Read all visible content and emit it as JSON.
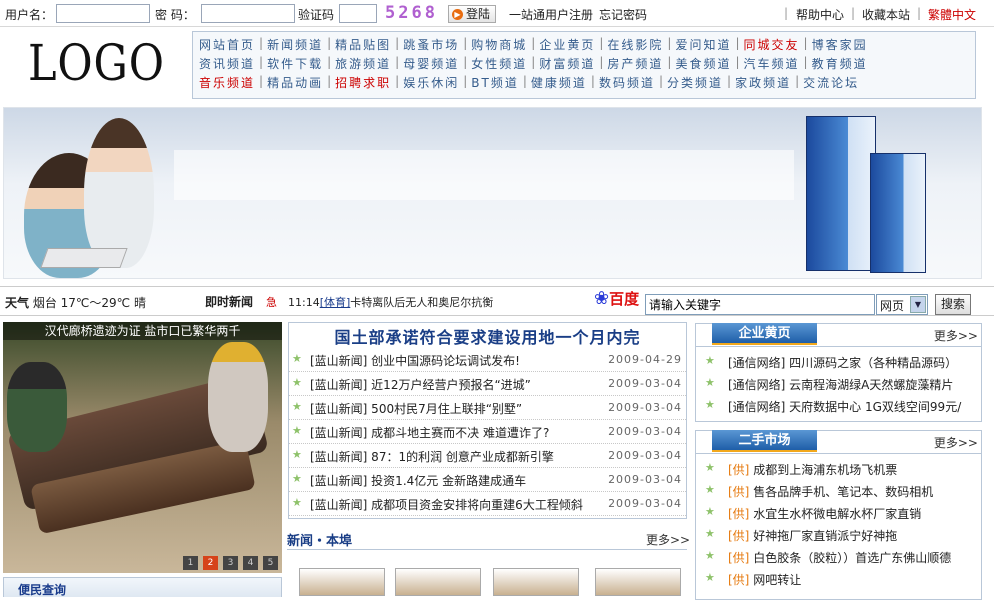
{
  "login": {
    "username_label": "用户名：",
    "password_label": "密 码：",
    "captcha_label": "验证码",
    "captcha_code": "5268",
    "login_button": "登陆",
    "register_link": "一站通用户注册",
    "forgot_link": "忘记密码",
    "help_link": "帮助中心",
    "bookmark_link": "收藏本站",
    "traditional_link": "繁體中文"
  },
  "logo": "LOGO",
  "nav": {
    "rows": [
      [
        "网站首页",
        "新闻频道",
        "精品贴图",
        "跳蚤市场",
        "购物商城",
        "企业黄页",
        "在线影院",
        "爱问知道",
        "同城交友",
        "博客家园"
      ],
      [
        "资讯频道",
        "软件下载",
        "旅游频道",
        "母婴频道",
        "女性频道",
        "财富频道",
        "房产频道",
        "美食频道",
        "汽车频道",
        "教育频道"
      ],
      [
        "音乐频道",
        "精品动画",
        "招聘求职",
        "娱乐休闲",
        "BT频道",
        "健康频道",
        "数码频道",
        "分类频道",
        "家政频道",
        "交流论坛"
      ]
    ],
    "red_items": [
      "同城交友",
      "音乐频道",
      "招聘求职"
    ]
  },
  "weather": {
    "label": "天气",
    "text": "烟台 17℃～29℃ 晴"
  },
  "news_ticker": {
    "label": "即时新闻",
    "icon": "急",
    "time": "11:14",
    "tag": "[体育]",
    "text": "卡特离队后无人和奥尼尔抗衡"
  },
  "search": {
    "brand": "百度",
    "placeholder": "请输入关键字",
    "type": "网页",
    "button": "搜索"
  },
  "photo": {
    "caption": "汉代廊桥遗迹为证 盐市口已繁华两千",
    "pages": [
      "1",
      "2",
      "3",
      "4",
      "5"
    ],
    "active_page": "2"
  },
  "bianmin": {
    "title": "便民查询"
  },
  "headline": "国土部承诺符合要求建设用地一个月内完",
  "news": [
    {
      "title": "[蓝山新闻] 创业中国源码论坛调试发布!",
      "date": "2009-04-29"
    },
    {
      "title": "[蓝山新闻] 近12万户经营户预报名“进城”",
      "date": "2009-03-04"
    },
    {
      "title": "[蓝山新闻] 500村民7月住上联排“别墅”",
      "date": "2009-03-04"
    },
    {
      "title": "[蓝山新闻] 成都斗地主赛而不决 难道遭诈了?",
      "date": "2009-03-04"
    },
    {
      "title": "[蓝山新闻] 87：1的利润  创意产业成都新引擎",
      "date": "2009-03-04"
    },
    {
      "title": "[蓝山新闻] 投资1.4亿元 金新路建成通车",
      "date": "2009-03-04"
    },
    {
      "title": "[蓝山新闻] 成都项目资金安排将向重建6大工程倾斜",
      "date": "2009-03-04"
    }
  ],
  "local_news": {
    "title": "新闻・本埠",
    "more": "更多>>"
  },
  "yellow_pages": {
    "title": "企业黄页",
    "more": "更多>>",
    "items": [
      "[通信网络] 四川源码之家（各种精品源码）",
      "[通信网络] 云南程海湖绿A天然螺旋藻精片",
      "[通信网络] 天府数据中心 1G双线空间99元/"
    ]
  },
  "second_hand": {
    "title": "二手市场",
    "more": "更多>>",
    "items": [
      {
        "kind": "[供]",
        "text": "成都到上海浦东机场飞机票"
      },
      {
        "kind": "[供]",
        "text": "售各品牌手机、笔记本、数码相机"
      },
      {
        "kind": "[供]",
        "text": "水宜生水杯微电解水杯厂家直销"
      },
      {
        "kind": "[供]",
        "text": "好神拖厂家直销派宁好神拖"
      },
      {
        "kind": "[供]",
        "text": "白色胶条（胶粒））首选广东佛山顺德"
      },
      {
        "kind": "[供]",
        "text": "网吧转让"
      }
    ]
  },
  "colors": {
    "nav_text": "#355c8c",
    "highlight_red": "#cc0000",
    "tab_blue": "#1e5ea8",
    "tab_orange": "#f2a81c",
    "supply_orange": "#e67a10"
  }
}
